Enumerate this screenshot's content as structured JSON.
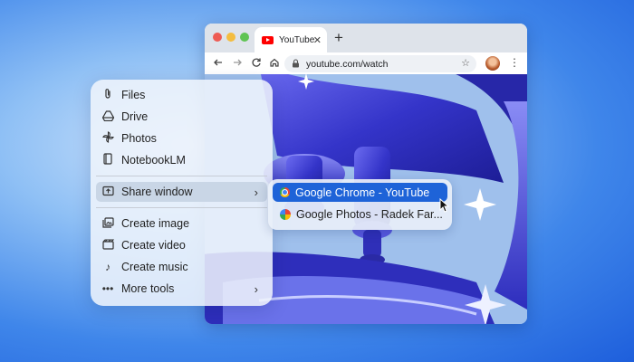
{
  "browser": {
    "tab_title": "YouTube",
    "tab_close": "✕",
    "new_tab": "+",
    "url": "youtube.com/watch",
    "icons": [
      "back-arrow-icon",
      "forward-arrow-icon",
      "reload-icon",
      "home-icon",
      "lock-icon",
      "star-icon",
      "avatar",
      "more-icon"
    ]
  },
  "menu": {
    "items": [
      {
        "label": "Files",
        "icon": "paperclip-icon"
      },
      {
        "label": "Drive",
        "icon": "drive-icon"
      },
      {
        "label": "Photos",
        "icon": "pinwheel-icon"
      },
      {
        "label": "NotebookLM",
        "icon": "notebook-icon"
      },
      {
        "label": "Share window",
        "icon": "share-window-icon",
        "highlighted": true
      },
      {
        "label": "Create image",
        "icon": "image-icon"
      },
      {
        "label": "Create video",
        "icon": "video-icon"
      },
      {
        "label": "Create music",
        "icon": "music-note-icon"
      },
      {
        "label": "More tools",
        "icon": "more-dots-icon"
      }
    ]
  },
  "submenu": {
    "items": [
      {
        "label": "Google Chrome - YouTube",
        "selected": true
      },
      {
        "label": "Google Photos - Radek Far...",
        "selected": false
      }
    ]
  },
  "colors": {
    "accent": "#1e63d8",
    "highlight": "#c9d6e6",
    "youtube_red": "#ff0000"
  }
}
